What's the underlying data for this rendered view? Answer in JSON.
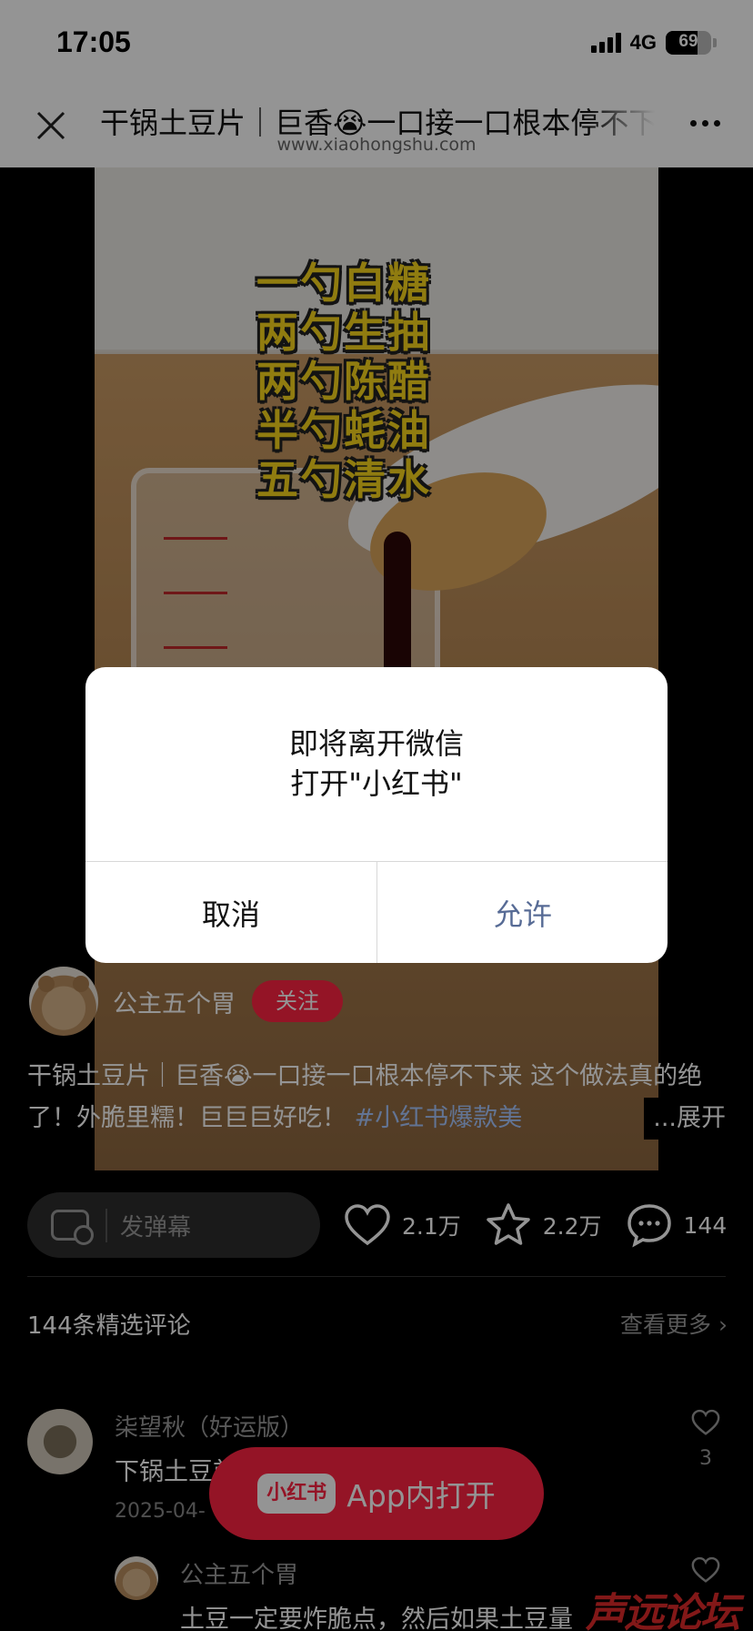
{
  "status_bar": {
    "time": "17:05",
    "network": "4G",
    "battery_percent": "69",
    "battery_level": 0.69
  },
  "nav": {
    "title": "干锅土豆片｜巨香😭一口接一口根本停不下来",
    "url": "www.xiaohongshu.com",
    "close_icon": "close-icon",
    "more_icon": "more-icon"
  },
  "video": {
    "overlay_text": [
      "一勺白糖",
      "两勺生抽",
      "两勺陈醋",
      "半勺蚝油",
      "五勺清水"
    ]
  },
  "author": {
    "name": "公主五个胃",
    "follow_label": "关注"
  },
  "description": {
    "text": "干锅土豆片｜巨香😭一口接一口根本停不下来 这个做法真的绝了！外脆里糯！巨巨巨好吃！ ",
    "tag": "#小红书爆款美",
    "expand_label": "...展开"
  },
  "actions": {
    "danmu_placeholder": "发弹幕",
    "likes": "2.1万",
    "favorites": "2.2万",
    "comments": "144"
  },
  "comments": {
    "title": "144条精选评论",
    "more_label": "查看更多",
    "items": [
      {
        "name": "柒望秋（好运版）",
        "text": "下锅土豆前",
        "date": "2025-04-",
        "likes": "3"
      },
      {
        "name": "公主五个胃",
        "text": "土豆一定要炸脆点，然后如果土豆量"
      }
    ]
  },
  "open_app": {
    "logo": "小红书",
    "label": "App内打开"
  },
  "dialog": {
    "line1": "即将离开微信",
    "line2": "打开\"小红书\"",
    "cancel_label": "取消",
    "allow_label": "允许"
  },
  "watermark": "声远论坛",
  "colors": {
    "brand_red": "#ff2442",
    "wechat_link_blue": "#576b95",
    "overlay_text_yellow": "#f8d61c"
  }
}
